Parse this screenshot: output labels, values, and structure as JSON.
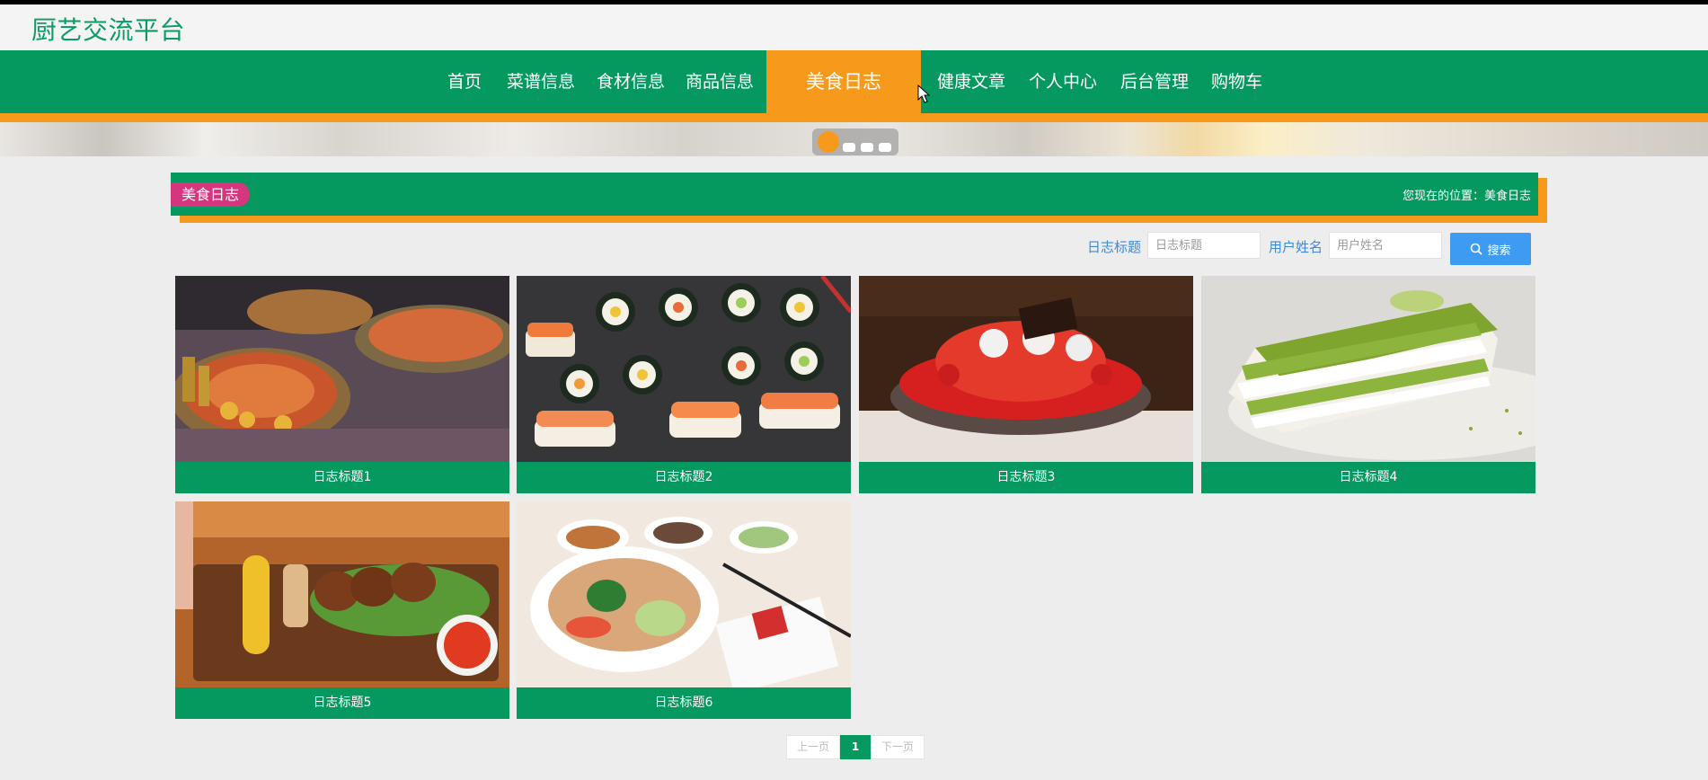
{
  "site": {
    "title": "厨艺交流平台"
  },
  "nav": {
    "items": [
      {
        "label": "首页"
      },
      {
        "label": "菜谱信息"
      },
      {
        "label": "食材信息"
      },
      {
        "label": "商品信息"
      },
      {
        "label": "美食日志",
        "active": true
      },
      {
        "label": "健康文章"
      },
      {
        "label": "个人中心"
      },
      {
        "label": "后台管理"
      },
      {
        "label": "购物车"
      }
    ]
  },
  "banner": {
    "slide_count": 4,
    "active_slide": 1
  },
  "breadcrumb": {
    "section": "美食日志",
    "location": "您现在的位置：美食日志"
  },
  "search": {
    "title_label": "日志标题",
    "title_placeholder": "日志标题",
    "user_label": "用户姓名",
    "user_placeholder": "用户姓名",
    "button_label": "搜索"
  },
  "cards": [
    {
      "title": "日志标题1",
      "image": "seafood-platter"
    },
    {
      "title": "日志标题2",
      "image": "sushi"
    },
    {
      "title": "日志标题3",
      "image": "strawberry-dessert"
    },
    {
      "title": "日志标题4",
      "image": "matcha-cake"
    },
    {
      "title": "日志标题5",
      "image": "grilled-skewers"
    },
    {
      "title": "日志标题6",
      "image": "noodle-bowl"
    }
  ],
  "pagination": {
    "prev": "上一页",
    "current": "1",
    "next": "下一页"
  },
  "colors": {
    "primary_green": "#05985f",
    "accent_orange": "#f79a1c",
    "tag_pink": "#d6367d",
    "search_blue": "#3d9bf2"
  }
}
